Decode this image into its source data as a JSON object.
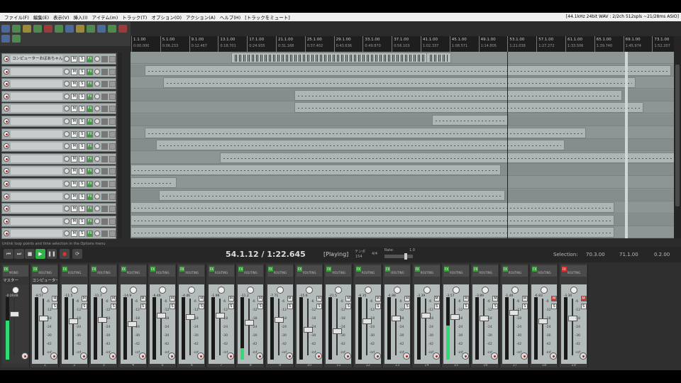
{
  "menu": [
    "ファイル(F)",
    "編集(E)",
    "表示(V)",
    "挿入(I)",
    "アイテム(m)",
    "トラック(T)",
    "オプション(O)",
    "アクション(A)",
    "ヘルプ(H)",
    "[トラックをミュート]"
  ],
  "status_info": "[44.1kHz 24bit WAV : 2/2ch 512spls ~21/28ms ASIO]",
  "tracks": {
    "first_name": "コンピューターおばあちゃん",
    "count": 15,
    "meter_color": "#2fdc74"
  },
  "ruler": {
    "bars": [
      "1.1.00",
      "5.1.00",
      "9.1.00",
      "13.1.00",
      "17.1.00",
      "21.1.00",
      "25.1.00",
      "29.1.00",
      "33.1.00",
      "37.1.00",
      "41.1.00",
      "45.1.00",
      "49.1.00",
      "53.1.00",
      "57.1.00",
      "61.1.00",
      "65.1.00",
      "69.1.00",
      "73.1.00"
    ],
    "times": [
      "0:00.000",
      "0:06.233",
      "0:12.467",
      "0:18.701",
      "0:24.935",
      "0:31.168",
      "0:37.402",
      "0:43.636",
      "0:49.870",
      "0:56.103",
      "1:02.337",
      "1:08.571",
      "1:14.805",
      "1:21.038",
      "1:27.272",
      "1:33.506",
      "1:39.740",
      "1:45.974",
      "1:52.207"
    ]
  },
  "tooltip": "Unlink loop points and time selection in the Options menu",
  "transport": {
    "position": "54.1.12 / 1:22.645",
    "state": "[Playing]",
    "tempo_label": "テンポ",
    "tempo": "154",
    "signature": "4/4",
    "rate_label": "Rate:",
    "rate": "1.0",
    "selection_label": "Selection:",
    "sel_start": "70.3.00",
    "sel_end": "71.1.00",
    "sel_length": "0.2.00"
  },
  "mixer": {
    "master_name": "マスター",
    "first_track_name": "コンピューターおば",
    "route_label": "ROUTING",
    "master_route_label": "MONO",
    "db_values": [
      "-0.00dB",
      "-8.57",
      "-11.5",
      "-11.7",
      "-14.9",
      "-6.46",
      "-4.46",
      "-1.96",
      "-11.2",
      "-7.71",
      "-15.6",
      "-21.5",
      "-8.35",
      "-4.88",
      "-3.39",
      "-3.57",
      "-3.89",
      "-1.46",
      "-6.83",
      "-3.30"
    ],
    "scale_labels": [
      "-6",
      "-12",
      "-18",
      "-24",
      "-30",
      "-42",
      "-inf"
    ],
    "numbers": [
      "1",
      "2",
      "3",
      "4",
      "5",
      "6",
      "7",
      "8",
      "9",
      "10",
      "11",
      "12",
      "13",
      "14",
      "15",
      "16",
      "17",
      "18",
      "19"
    ],
    "accent": "#2fdc74",
    "mute_color": "#cc3333"
  }
}
